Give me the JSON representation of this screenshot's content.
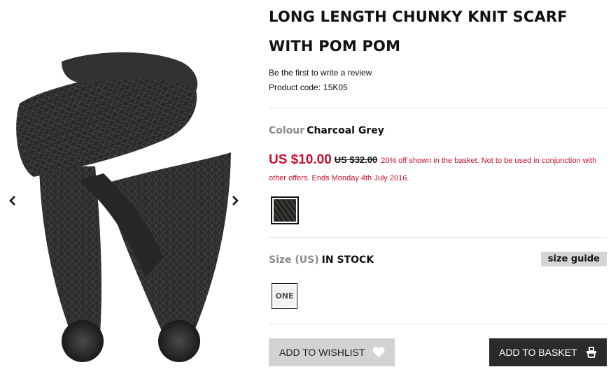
{
  "gallery": {
    "prev_icon": "chevron-left-icon",
    "next_icon": "chevron-right-icon",
    "image_alt": "charcoal chunky knit scarf with pom poms"
  },
  "product": {
    "title_line1": "LONG LENGTH CHUNKY KNIT SCARF",
    "title_line2": "WITH POM POM",
    "review_link": "Be the first to write a review",
    "code_label": "Product code:",
    "code_value": "15K05"
  },
  "colour": {
    "label": "Colour",
    "value": "Charcoal Grey",
    "swatch_color": "#2a2a28"
  },
  "price": {
    "now": "US $10.00",
    "was": "US $32.00",
    "promo": "20% off shown in the basket. Not to be used in conjunction with other offers. Ends Monday 4th July 2016.",
    "sale_color": "#c8102e"
  },
  "size": {
    "label": "Size (US)",
    "stock": "IN STOCK",
    "guide": "size guide",
    "options": [
      "ONE"
    ]
  },
  "actions": {
    "wishlist": "ADD TO WISHLIST",
    "wishlist_icon": "heart-icon",
    "basket": "ADD TO BASKET",
    "basket_icon": "basket-icon"
  }
}
